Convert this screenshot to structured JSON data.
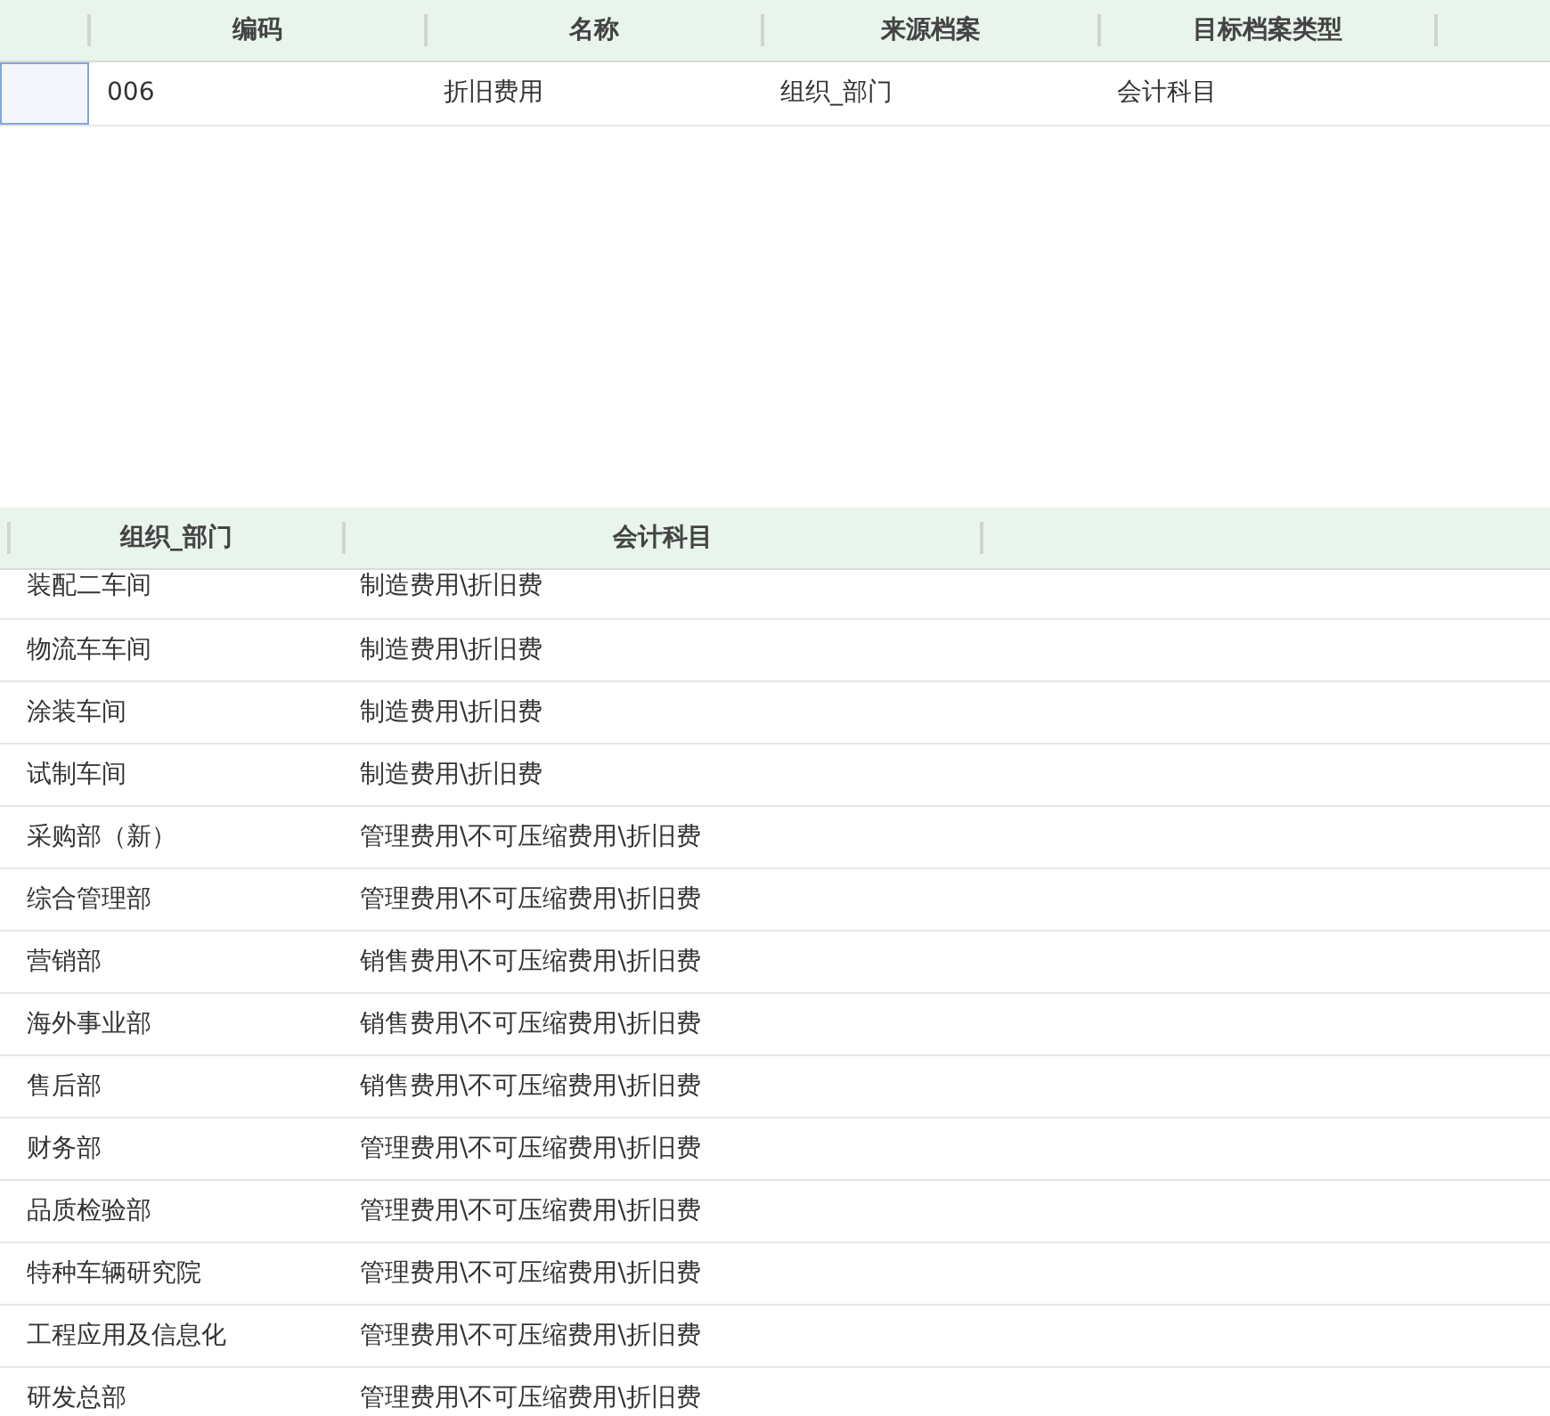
{
  "top_table": {
    "columns": [
      "编码",
      "名称",
      "来源档案",
      "目标档案类型"
    ],
    "rows": [
      {
        "selected": true,
        "cells": [
          "006",
          "折旧费用",
          "组织_部门",
          "会计科目"
        ]
      }
    ]
  },
  "mapping_table": {
    "columns": [
      "组织_部门",
      "会计科目"
    ],
    "rows": [
      [
        "装配二车间",
        "制造费用\\折旧费"
      ],
      [
        "物流车车间",
        "制造费用\\折旧费"
      ],
      [
        "涂装车间",
        "制造费用\\折旧费"
      ],
      [
        "试制车间",
        "制造费用\\折旧费"
      ],
      [
        "采购部（新）",
        "管理费用\\不可压缩费用\\折旧费"
      ],
      [
        "综合管理部",
        "管理费用\\不可压缩费用\\折旧费"
      ],
      [
        "营销部",
        "销售费用\\不可压缩费用\\折旧费"
      ],
      [
        "海外事业部",
        "销售费用\\不可压缩费用\\折旧费"
      ],
      [
        "售后部",
        "销售费用\\不可压缩费用\\折旧费"
      ],
      [
        "财务部",
        "管理费用\\不可压缩费用\\折旧费"
      ],
      [
        "品质检验部",
        "管理费用\\不可压缩费用\\折旧费"
      ],
      [
        "特种车辆研究院",
        "管理费用\\不可压缩费用\\折旧费"
      ],
      [
        "工程应用及信息化",
        "管理费用\\不可压缩费用\\折旧费"
      ],
      [
        "研发总部",
        "管理费用\\不可压缩费用\\折旧费"
      ]
    ]
  }
}
